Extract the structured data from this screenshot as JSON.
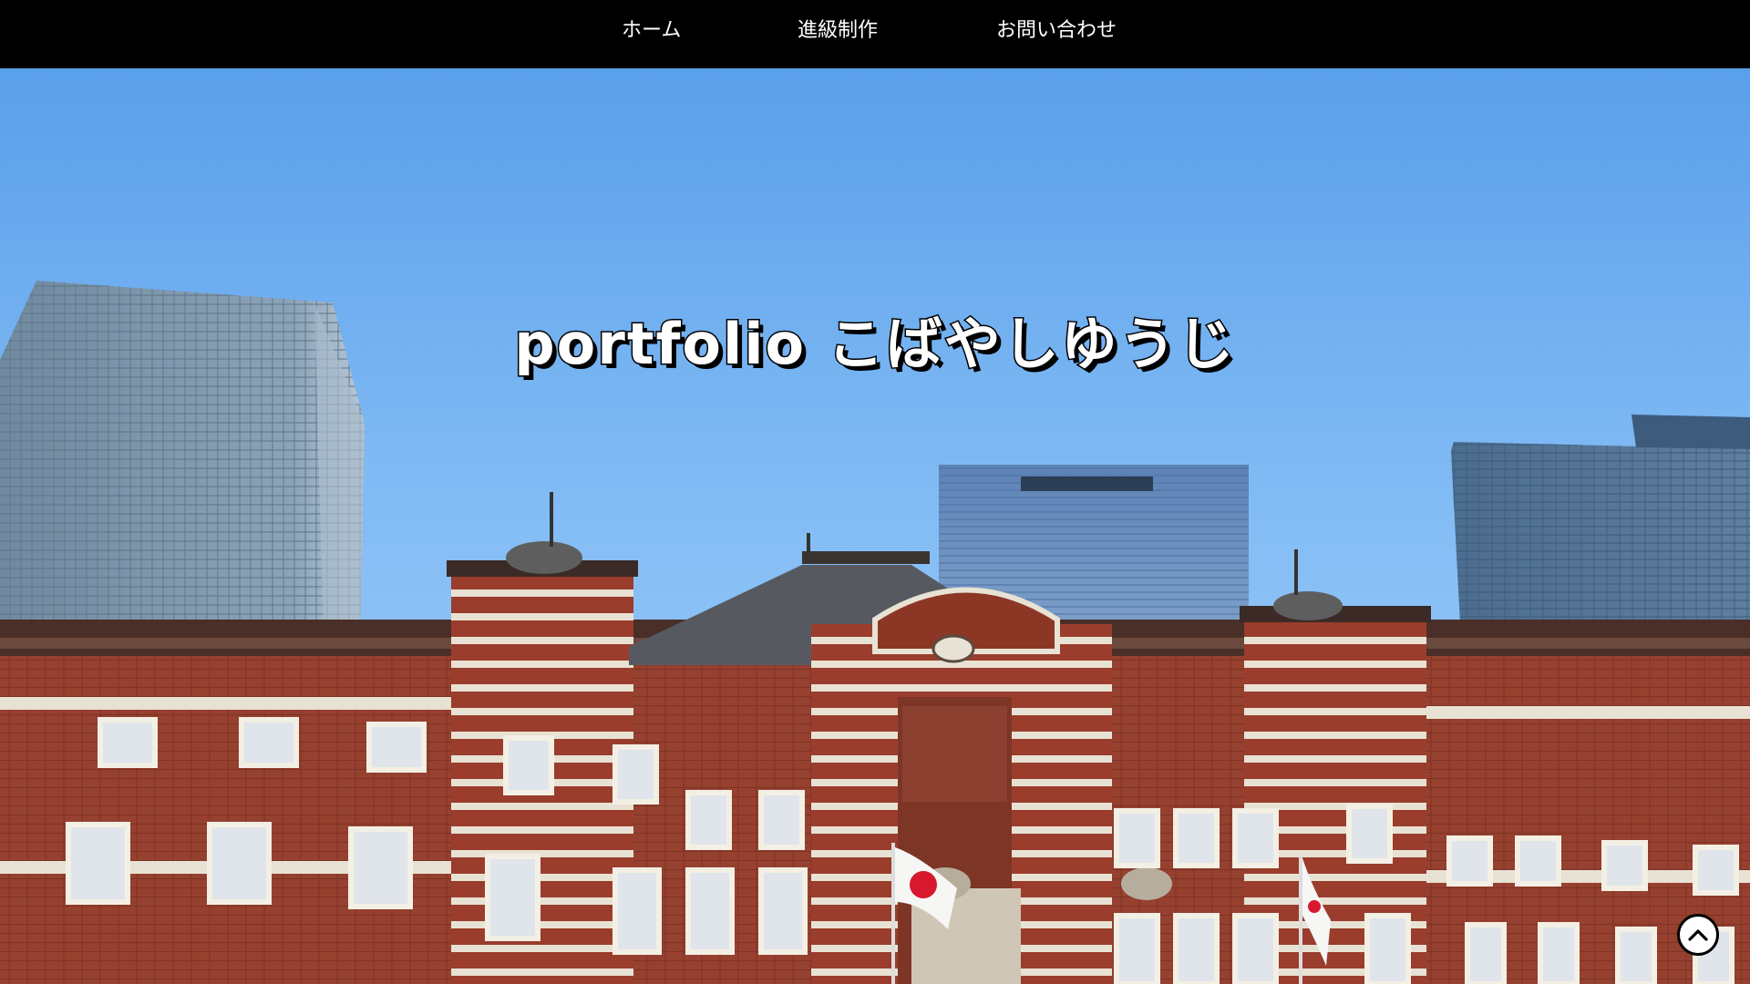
{
  "nav": {
    "items": [
      {
        "label": "ホーム"
      },
      {
        "label": "進級制作"
      },
      {
        "label": "お問い合わせ"
      }
    ]
  },
  "hero": {
    "title": "portfolio こばやしゆうじ",
    "image": "tokyo-station-photo"
  },
  "back_to_top": {
    "icon": "chevron-up-icon"
  },
  "colors": {
    "nav_bg": "#000000",
    "nav_text": "#ffffff",
    "sky": "#7bb6f3",
    "brick": "#9a3b2a"
  }
}
